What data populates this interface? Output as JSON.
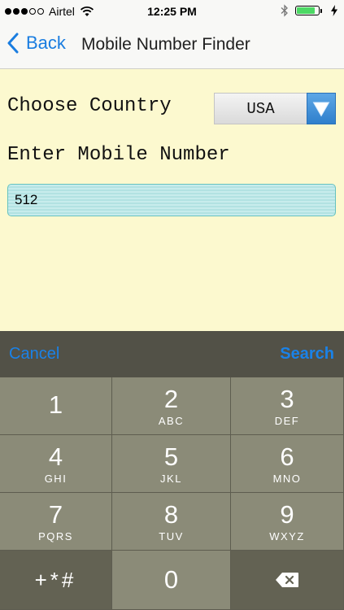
{
  "status_bar": {
    "carrier": "Airtel",
    "time": "12:25 PM",
    "signal_full": 3,
    "signal_total": 5,
    "battery_level": 0.85,
    "battery_color": "#4cd964"
  },
  "nav": {
    "back_label": "Back",
    "title": "Mobile Number Finder",
    "accent": "#1a7de0"
  },
  "form": {
    "choose_label": "Choose Country",
    "country_value": "USA",
    "enter_label": "Enter Mobile Number",
    "number_value": "512"
  },
  "toolbar": {
    "cancel_label": "Cancel",
    "search_label": "Search"
  },
  "keypad": {
    "keys": [
      {
        "digit": "1",
        "letters": ""
      },
      {
        "digit": "2",
        "letters": "ABC"
      },
      {
        "digit": "3",
        "letters": "DEF"
      },
      {
        "digit": "4",
        "letters": "GHI"
      },
      {
        "digit": "5",
        "letters": "JKL"
      },
      {
        "digit": "6",
        "letters": "MNO"
      },
      {
        "digit": "7",
        "letters": "PQRS"
      },
      {
        "digit": "8",
        "letters": "TUV"
      },
      {
        "digit": "9",
        "letters": "WXYZ"
      }
    ],
    "symbols": "+*#",
    "zero": "0",
    "icons": [
      "delete-icon"
    ]
  }
}
